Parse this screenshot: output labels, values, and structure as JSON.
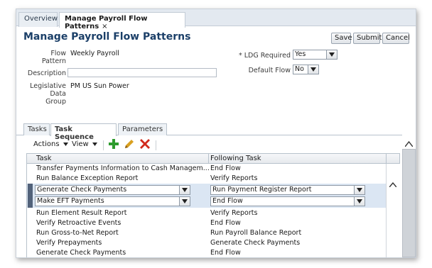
{
  "doc_tabs": {
    "overview": "Overview",
    "active": "Manage Payroll Flow Patterns",
    "close_glyph": "×"
  },
  "page": {
    "title": "Manage Payroll Flow Patterns"
  },
  "buttons": {
    "save": "Save",
    "submit": "Submit",
    "cancel": "Cancel"
  },
  "form": {
    "flow_pattern_label_1": "Flow",
    "flow_pattern_label_2": "Pattern",
    "flow_pattern_value": "Weekly Payroll",
    "description_label": "Description",
    "description_value": "",
    "ldg_label_1": "Legislative",
    "ldg_label_2": "Data",
    "ldg_label_3": "Group",
    "ldg_value": "PM US Sun Power",
    "ldg_required_label": "* LDG Required",
    "ldg_required_value": "Yes",
    "default_flow_label": "Default Flow",
    "default_flow_value": "No"
  },
  "sub_tabs": {
    "tasks": "Tasks",
    "task_sequence": "Task Sequence",
    "parameters": "Parameters"
  },
  "toolbar": {
    "actions": "Actions",
    "view": "View"
  },
  "table": {
    "columns": [
      "Task",
      "Following Task"
    ],
    "rows": [
      {
        "task": "Transfer Payments Information to Cash Managem...",
        "following": "End Flow"
      },
      {
        "task": "Run Balance Exception Report",
        "following": "Verify Reports"
      },
      {
        "task": "Generate Check Payments",
        "following": "Run Payment Register Report"
      },
      {
        "task": "Make EFT Payments",
        "following": "End Flow"
      },
      {
        "task": "Run Element Result Report",
        "following": "Verify Reports"
      },
      {
        "task": "Verify Retroactive Events",
        "following": "End Flow"
      },
      {
        "task": "Run Gross-to-Net Report",
        "following": "Run Payroll Balance Report"
      },
      {
        "task": "Verify Prepayments",
        "following": "Generate Check Payments"
      },
      {
        "task": "Generate Check Payments",
        "following": "End Flow"
      }
    ]
  },
  "colors": {
    "title": "#1b3f68",
    "add_icon": "#2e9b2e",
    "delete_icon": "#d12a1c",
    "edit_icon": "#d9a020"
  }
}
